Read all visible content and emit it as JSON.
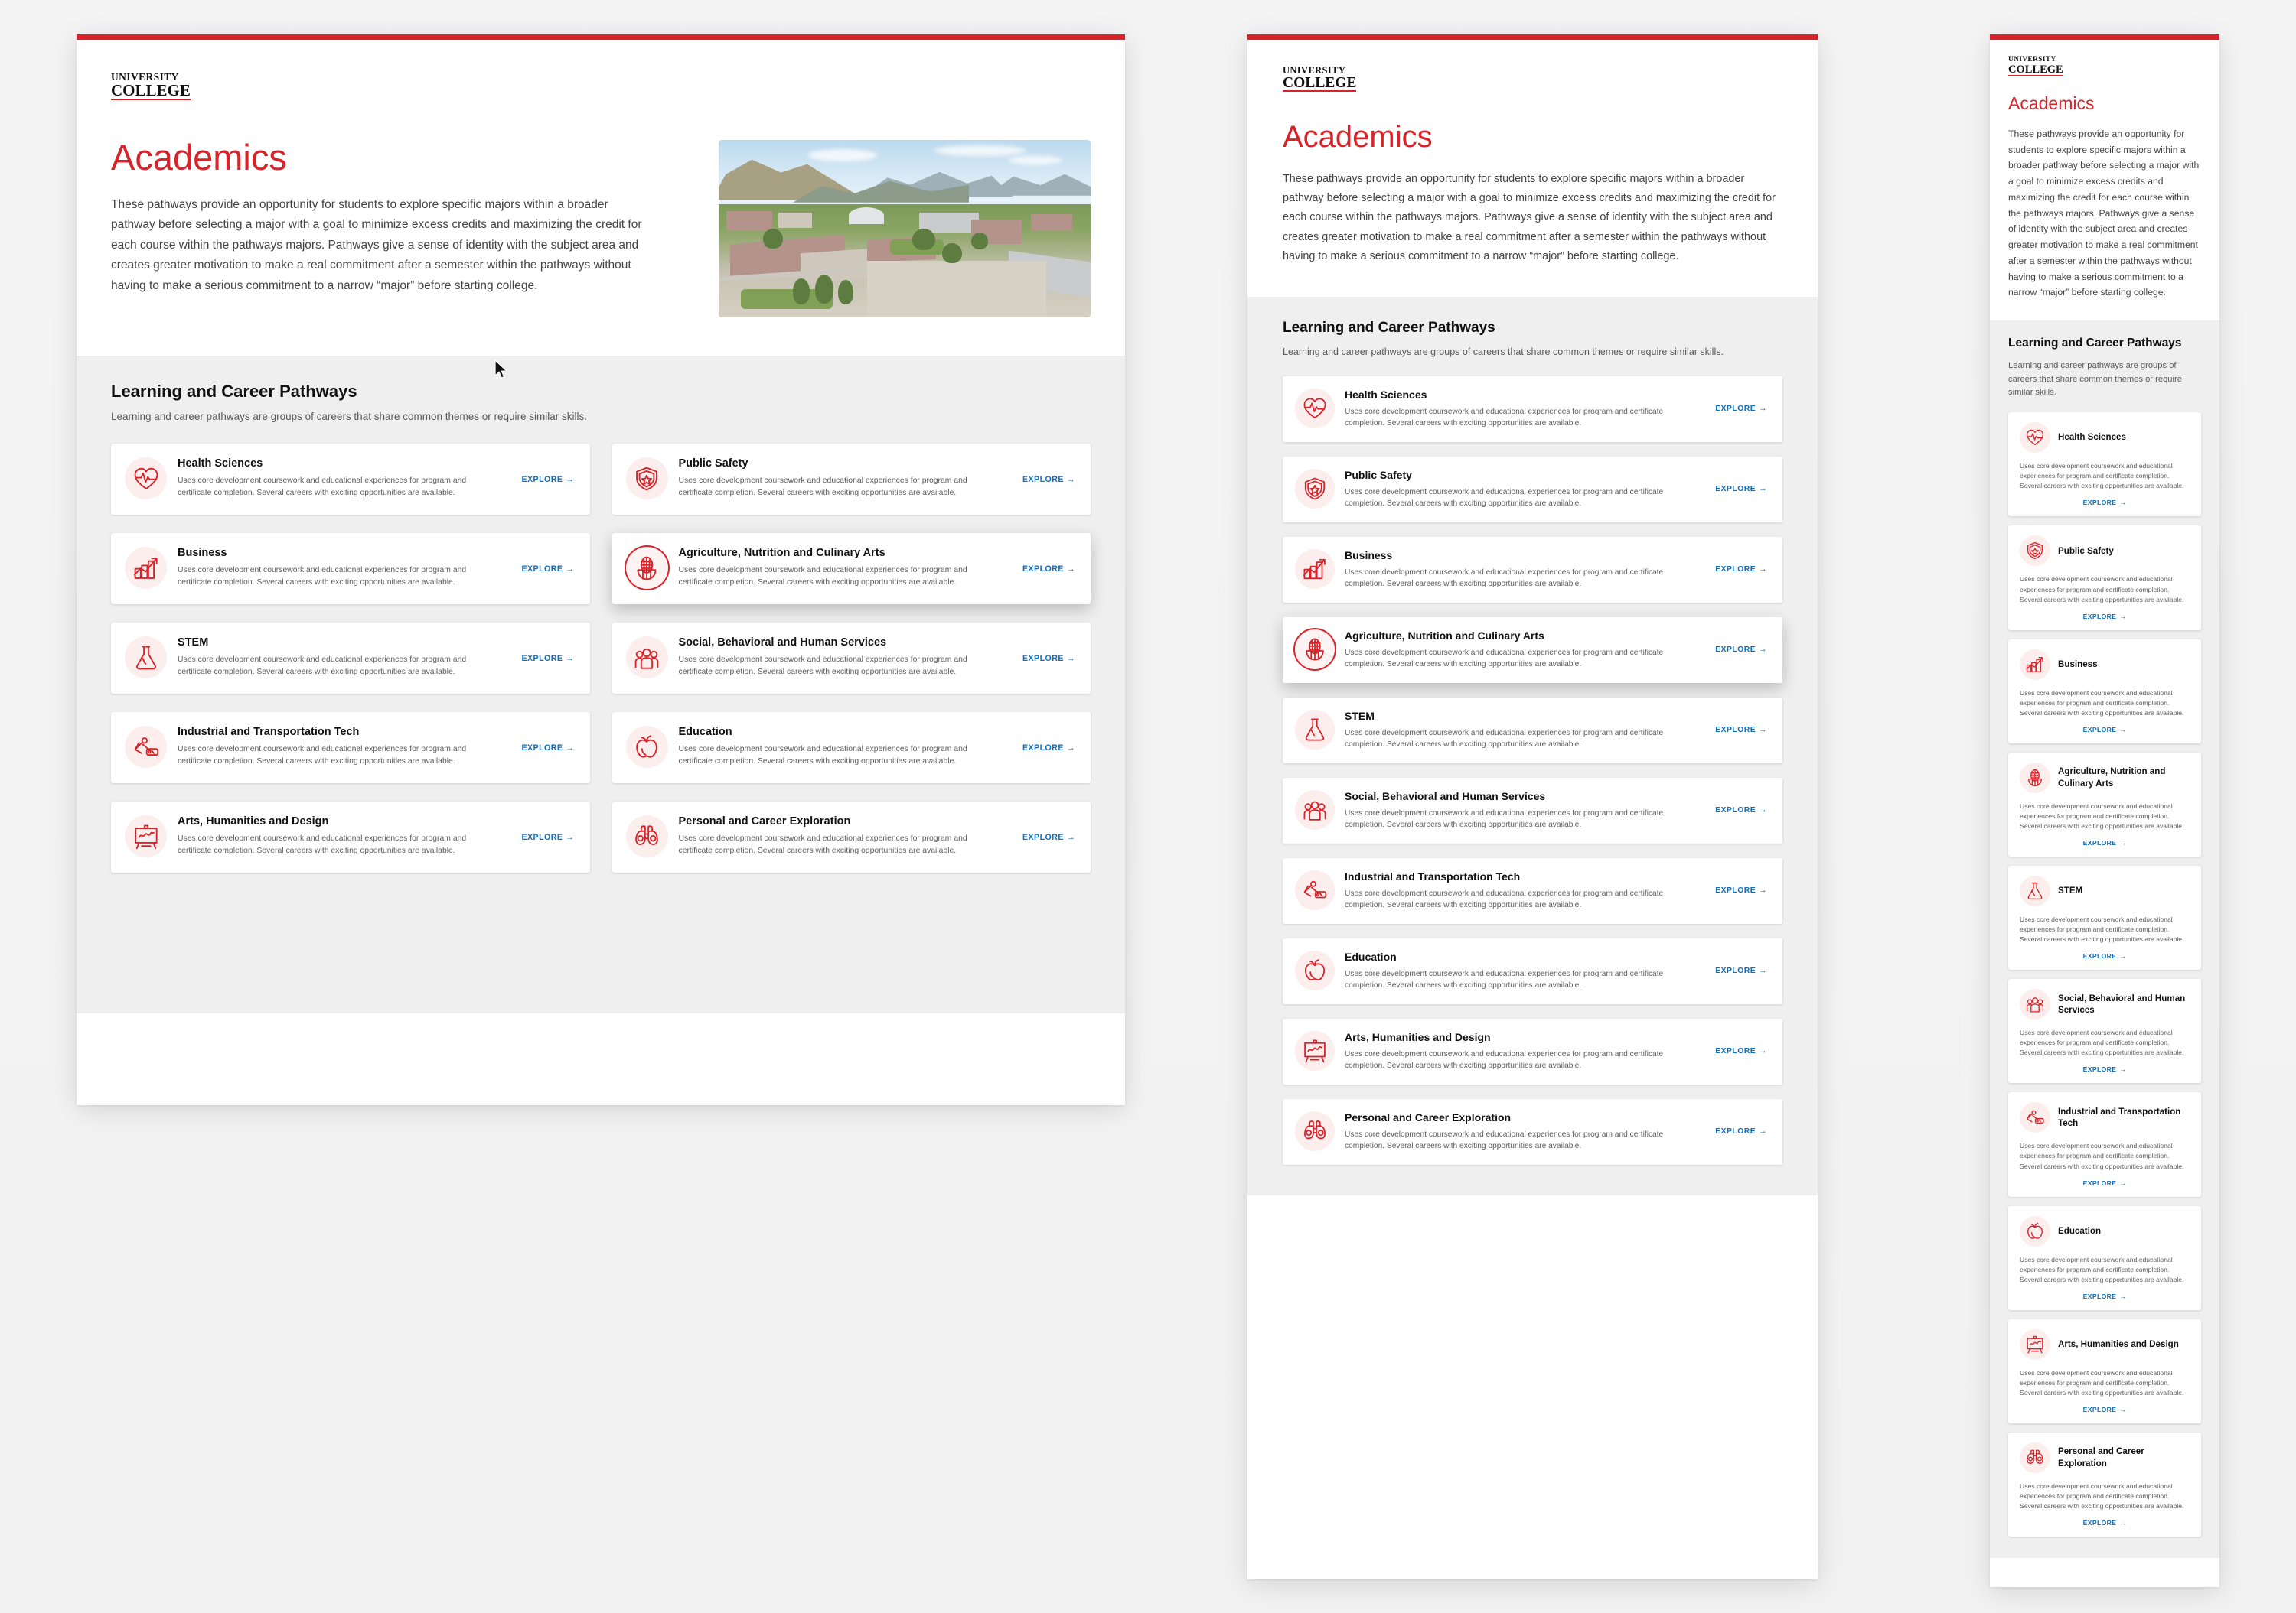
{
  "brand": {
    "logo_line1": "UNIVERSITY",
    "logo_line2": "COLLEGE",
    "accent_red": "#d8232a",
    "link_blue": "#0d6ebf",
    "icon_bg": "#fdeeee",
    "section_bg": "#efefef"
  },
  "page": {
    "title": "Academics",
    "intro": "These pathways provide an opportunity for students to explore specific majors within a broader pathway before selecting a major with a goal to minimize excess credits and maximizing the credit for each course within the pathways majors. Pathways give a sense of identity with the subject area and creates greater motivation to make a real commitment after a semester within the pathways without having to make a serious commitment to a narrow “major” before starting college.",
    "hero_image_alt": "Aerial photo of university campus with mountains"
  },
  "pathways_section": {
    "heading": "Learning and Career Pathways",
    "subheading": "Learning and career pathways are groups of careers that share common themes or require similar skills.",
    "explore_label": "EXPLORE",
    "explore_arrow": "→"
  },
  "card_description": "Uses core development coursework and educational experiences for program and certificate completion. Several careers with exciting opportunities are available.",
  "pathways": [
    {
      "id": "health-sciences",
      "title": "Health Sciences",
      "icon": "heart-pulse-icon"
    },
    {
      "id": "public-safety",
      "title": "Public Safety",
      "icon": "shield-star-icon"
    },
    {
      "id": "business",
      "title": "Business",
      "icon": "bar-chart-icon"
    },
    {
      "id": "agriculture-nutrition-culinary-arts",
      "title": "Agriculture, Nutrition and Culinary Arts",
      "icon": "corn-icon"
    },
    {
      "id": "stem",
      "title": "STEM",
      "icon": "flask-icon"
    },
    {
      "id": "social-behavioral-human-services",
      "title": "Social, Behavioral and Human Services",
      "icon": "people-group-icon"
    },
    {
      "id": "industrial-transportation-tech",
      "title": "Industrial and Transportation Tech",
      "icon": "tools-icon"
    },
    {
      "id": "education",
      "title": "Education",
      "icon": "apple-icon"
    },
    {
      "id": "arts-humanities-design",
      "title": "Arts, Humanities and Design",
      "icon": "easel-icon"
    },
    {
      "id": "personal-career-exploration",
      "title": "Personal and Career Exploration",
      "icon": "binoculars-icon"
    }
  ],
  "desktop_order": [
    0,
    1,
    2,
    3,
    4,
    5,
    6,
    7,
    8,
    9
  ],
  "stacked_order": [
    0,
    1,
    2,
    3,
    4,
    5,
    6,
    7,
    8,
    9
  ],
  "hovered_card_id": "agriculture-nutrition-culinary-arts"
}
